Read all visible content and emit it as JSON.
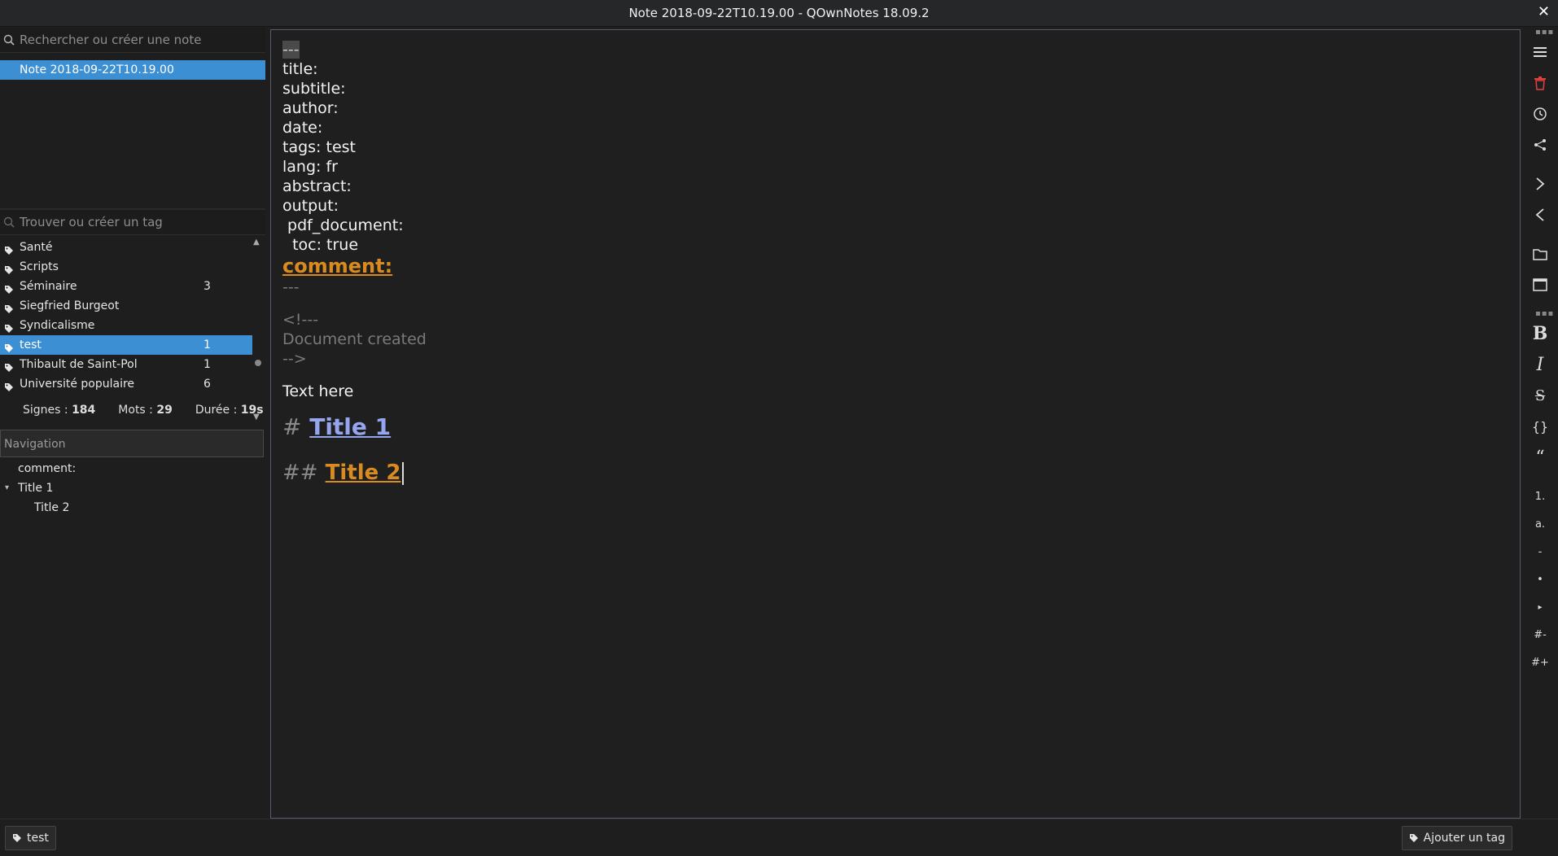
{
  "window": {
    "title": "Note 2018-09-22T10.19.00 - QOwnNotes 18.09.2",
    "close_glyph": "✕"
  },
  "note_search": {
    "placeholder": "Rechercher ou créer une note",
    "value": ""
  },
  "notes": [
    {
      "title": "Note 2018-09-22T10.19.00",
      "selected": true
    }
  ],
  "tag_search": {
    "placeholder": "Trouver ou créer un tag",
    "value": ""
  },
  "tags": [
    {
      "name": "Santé",
      "count": ""
    },
    {
      "name": "Scripts",
      "count": ""
    },
    {
      "name": "Séminaire",
      "count": "3"
    },
    {
      "name": "Siegfried Burgeot",
      "count": ""
    },
    {
      "name": "Syndicalisme",
      "count": ""
    },
    {
      "name": "test",
      "count": "1",
      "selected": true
    },
    {
      "name": "Thibault de Saint-Pol",
      "count": "1"
    },
    {
      "name": "Université populaire",
      "count": "6"
    }
  ],
  "stats": {
    "signs_label": "Signes : ",
    "signs_value": "184",
    "words_label": "Mots : ",
    "words_value": "29",
    "duration_label": "Durée : ",
    "duration_value": "19s"
  },
  "navigation": {
    "header": "Navigation",
    "items": [
      {
        "label": "comment:",
        "level": 0
      },
      {
        "label": "Title 1",
        "level": 0,
        "expanded": true
      },
      {
        "label": "Title 2",
        "level": 1
      }
    ]
  },
  "editor": {
    "frontmatter_open": "---",
    "lines": [
      "title:",
      "subtitle:",
      "author:",
      "date:",
      "tags: test",
      "lang: fr",
      "abstract:",
      "output:",
      " pdf_document:",
      "  toc: true"
    ],
    "comment_heading": "comment:",
    "frontmatter_close": "---",
    "html_comment_open": "<!---",
    "html_comment_body": "Document created",
    "html_comment_close": "-->",
    "body_text": "Text here",
    "h1_hash": "#",
    "h1_text": "Title 1",
    "h2_hash": "##",
    "h2_text": "Title 2"
  },
  "toolbar": {
    "bold": "B",
    "italic": "I",
    "strike": "S",
    "code": "{}",
    "quote": "“",
    "ordered_list": "1.",
    "alpha_list": "a.",
    "dash_list": "-",
    "bullet_list": "•",
    "triangle_list": "▸",
    "heading_decrease": "#-",
    "heading_increase": "#+"
  },
  "bottom": {
    "current_tag": "test",
    "add_tag_label": "Ajouter un tag"
  },
  "colors": {
    "accent": "#3d8fd3",
    "heading1": "#95a5f0",
    "heading2": "#d98b1f",
    "trash": "#e04040"
  }
}
